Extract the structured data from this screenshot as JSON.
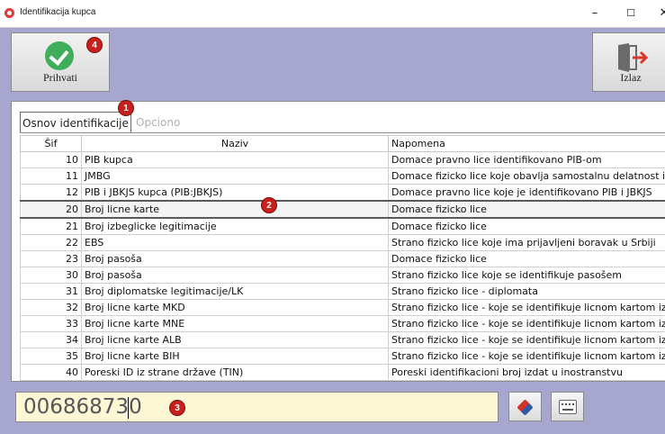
{
  "window": {
    "title": "Identifikacija kupca",
    "controls": {
      "minimize": "–",
      "maximize": "☐",
      "close": "✕"
    }
  },
  "toolbar": {
    "accept_label": "Prihvati",
    "exit_label": "Izlaz"
  },
  "markers": [
    "1",
    "2",
    "3",
    "4"
  ],
  "tabs": [
    {
      "label": "Osnov identifikacije",
      "active": true
    },
    {
      "label": "Opciono",
      "active": false
    }
  ],
  "grid": {
    "columns": [
      "Šif",
      "Naziv",
      "Napomena"
    ],
    "rows": [
      {
        "sif": "10",
        "naziv": "PIB kupca",
        "napomena": "Domace pravno lice identifikovano PIB-om"
      },
      {
        "sif": "11",
        "naziv": "JMBG",
        "napomena": "Domace fizicko lice koje obavlja samostalnu delatnost ide"
      },
      {
        "sif": "12",
        "naziv": "PIB i JBKJS kupca (PIB:JBKJS)",
        "napomena": "Domace pravno lice koje je identifikovano PIB i JBKJS"
      },
      {
        "sif": "20",
        "naziv": "Broj licne karte",
        "napomena": "Domace fizicko lice"
      },
      {
        "sif": "21",
        "naziv": "Broj izbeglicke legitimacije",
        "napomena": "Domace fizicko lice"
      },
      {
        "sif": "22",
        "naziv": "EBS",
        "napomena": "Strano fizicko lice koje ima prijavljeni boravak u Srbiji"
      },
      {
        "sif": "23",
        "naziv": "Broj pasoša",
        "napomena": "Domace fizicko lice"
      },
      {
        "sif": "30",
        "naziv": "Broj pasoša",
        "napomena": "Strano fizicko lice koje se identifikuje pasošem"
      },
      {
        "sif": "31",
        "naziv": "Broj diplomatske legitimacije/LK",
        "napomena": "Strano fizicko lice - diplomata"
      },
      {
        "sif": "32",
        "naziv": "Broj licne karte MKD",
        "napomena": "Strano fizicko lice - koje se identifikuje licnom kartom iz N"
      },
      {
        "sif": "33",
        "naziv": "Broj licne karte MNE",
        "napomena": "Strano fizicko lice - koje se identifikuje licnom kartom iz C"
      },
      {
        "sif": "34",
        "naziv": "Broj licne karte ALB",
        "napomena": "Strano fizicko lice - koje se identifikuje licnom kartom iz A"
      },
      {
        "sif": "35",
        "naziv": "Broj licne karte BIH",
        "napomena": "Strano fizicko lice - koje se identifikuje licnom kartom iz E"
      },
      {
        "sif": "40",
        "naziv": "Poreski ID iz strane države (TIN)",
        "napomena": "Poreski identifikacioni broj izdat u inostranstvu"
      }
    ],
    "selected_sif": "20"
  },
  "input": {
    "value": "006868730"
  },
  "colors": {
    "background": "#a6a6cf",
    "accept_green": "#3fae5a",
    "marker_red": "#c8201a",
    "input_bg": "#fdf7d6"
  },
  "icons": [
    "check-icon",
    "exit-door-icon",
    "eraser-icon",
    "keyboard-icon"
  ]
}
